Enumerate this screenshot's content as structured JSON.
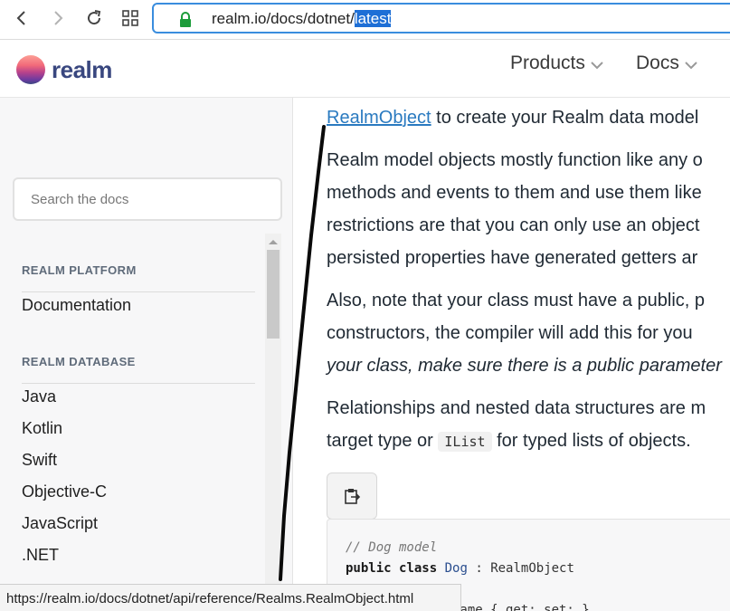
{
  "browser": {
    "url_prefix": "realm.io/docs/dotnet/",
    "url_selected": "latest",
    "status_url": "https://realm.io/docs/dotnet/api/reference/Realms.RealmObject.html"
  },
  "header": {
    "logo_text": "realm",
    "menu": [
      {
        "label": "Products"
      },
      {
        "label": "Docs"
      }
    ]
  },
  "sidebar": {
    "search_placeholder": "Search the docs",
    "sections": [
      {
        "title": "REALM PLATFORM",
        "items": [
          "Documentation"
        ]
      },
      {
        "title": "REALM DATABASE",
        "items": [
          "Java",
          "Kotlin",
          "Swift",
          "Objective-C",
          "JavaScript",
          ".NET"
        ]
      }
    ]
  },
  "content": {
    "line1_link": "RealmObject",
    "line1_rest": " to create your Realm data model",
    "para1": [
      "Realm model objects mostly function like any o",
      "methods and events to them and use them like",
      "restrictions are that you can only use an object",
      "persisted properties have generated getters ar"
    ],
    "para2": [
      "Also, note that your class must have a public, p",
      "constructors, the compiler will add this for you"
    ],
    "para2_italic": "your class, make sure there is a public parameter",
    "para3_line1": "Relationships and nested data structures are m",
    "para3_line2_a": "target type or ",
    "para3_code": "IList",
    "para3_line2_b": " for typed lists of objects.",
    "code": {
      "comment": "// Dog model",
      "kw_public": "public",
      "kw_class": "class",
      "class_name": "Dog",
      "sep": " : ",
      "base": "RealmObject",
      "partial_line": "    public string Name { get; set; }"
    }
  },
  "colors": {
    "link": "#2a7ac0",
    "brand": "#39477f",
    "selection": "#1e6fd6",
    "address_border": "#3a8dde"
  }
}
